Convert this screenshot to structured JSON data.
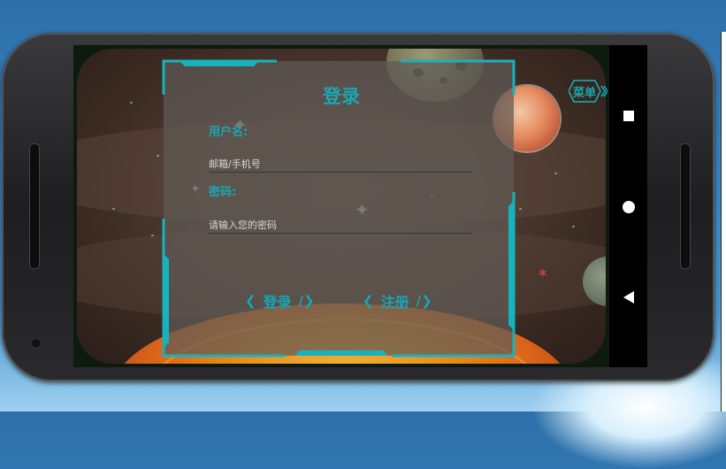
{
  "screen": {
    "title": "登录",
    "username_label": "用户名:",
    "username_placeholder": "邮箱/手机号",
    "password_label": "密码:",
    "password_placeholder": "请输入您的密码",
    "login_button": "登录",
    "register_button": "注册",
    "menu_label": "菜单"
  },
  "glyphs": {
    "chevron_left": "❮",
    "close_tag": "/❯"
  },
  "nav": {
    "recent_icon": "overview-square-icon",
    "home_icon": "home-circle-icon",
    "back_icon": "back-triangle-icon"
  },
  "colors": {
    "accent": "#1aa7b1",
    "panel": "#5f5a56"
  }
}
